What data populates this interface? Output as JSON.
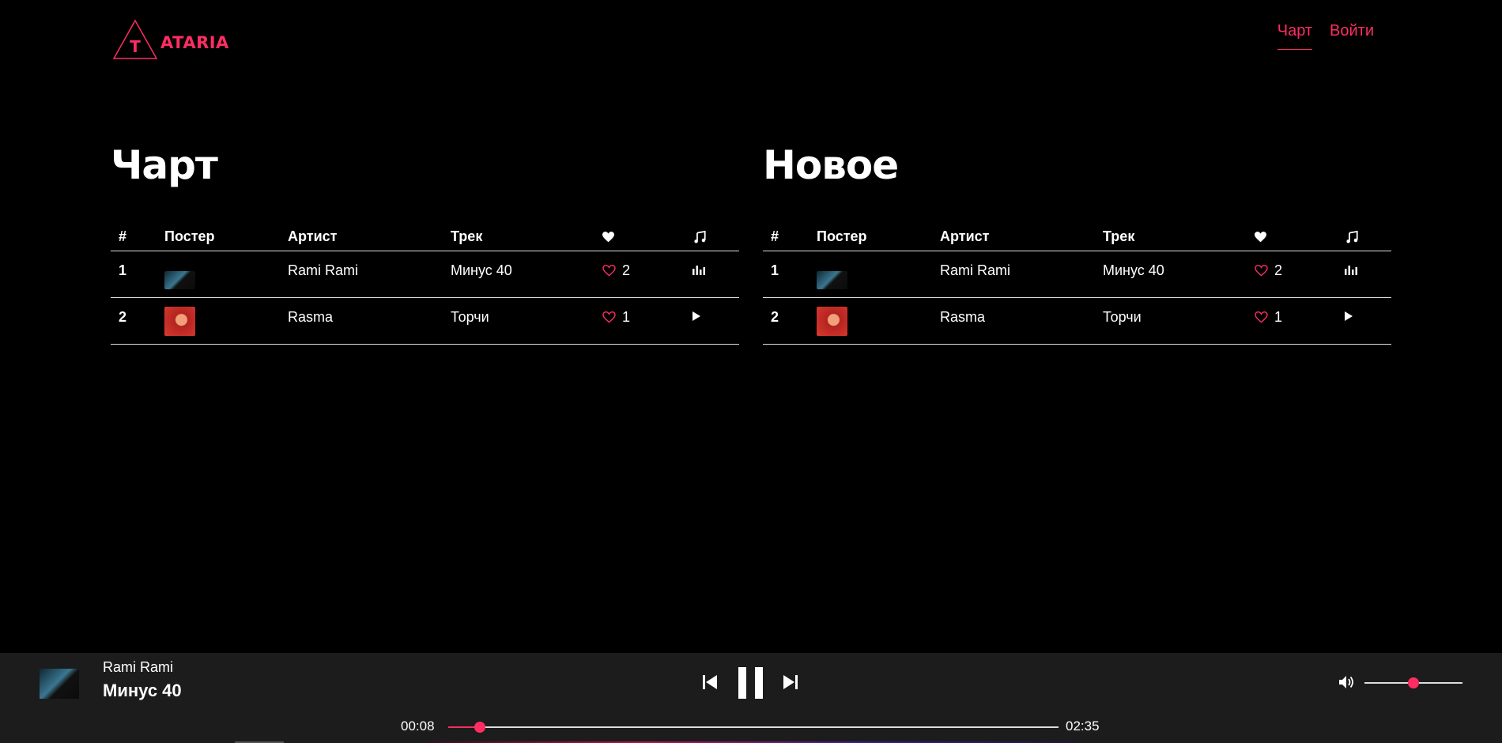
{
  "brand": {
    "logo_letter": "T",
    "name": "ATARIA",
    "accent": "#ff2d62"
  },
  "nav": {
    "items": [
      {
        "label": "Чарт",
        "active": true
      },
      {
        "label": "Войти",
        "active": false
      }
    ]
  },
  "sections": [
    {
      "title": "Чарт",
      "headers": {
        "num": "#",
        "poster": "Постер",
        "artist": "Артист",
        "track": "Трек",
        "likes_icon": "heart-icon",
        "play_icon": "music-note-icon"
      },
      "rows": [
        {
          "num": "1",
          "poster_icon": "poster-thumbnail",
          "artist": "Rami Rami",
          "track": "Минус 40",
          "likes": "2",
          "state_icon": "equalizer-icon"
        },
        {
          "num": "2",
          "poster_icon": "poster-thumbnail",
          "artist": "Rasma",
          "track": "Торчи",
          "likes": "1",
          "state_icon": "play-icon"
        }
      ]
    },
    {
      "title": "Новое",
      "headers": {
        "num": "#",
        "poster": "Постер",
        "artist": "Артист",
        "track": "Трек",
        "likes_icon": "heart-icon",
        "play_icon": "music-note-icon"
      },
      "rows": [
        {
          "num": "1",
          "poster_icon": "poster-thumbnail",
          "artist": "Rami Rami",
          "track": "Минус 40",
          "likes": "2",
          "state_icon": "equalizer-icon"
        },
        {
          "num": "2",
          "poster_icon": "poster-thumbnail",
          "artist": "Rasma",
          "track": "Торчи",
          "likes": "1",
          "state_icon": "play-icon"
        }
      ]
    }
  ],
  "player": {
    "artist": "Rami Rami",
    "track": "Минус 40",
    "current_time": "00:08",
    "duration": "02:35",
    "progress_fraction": 0.052,
    "volume_fraction": 0.5
  }
}
